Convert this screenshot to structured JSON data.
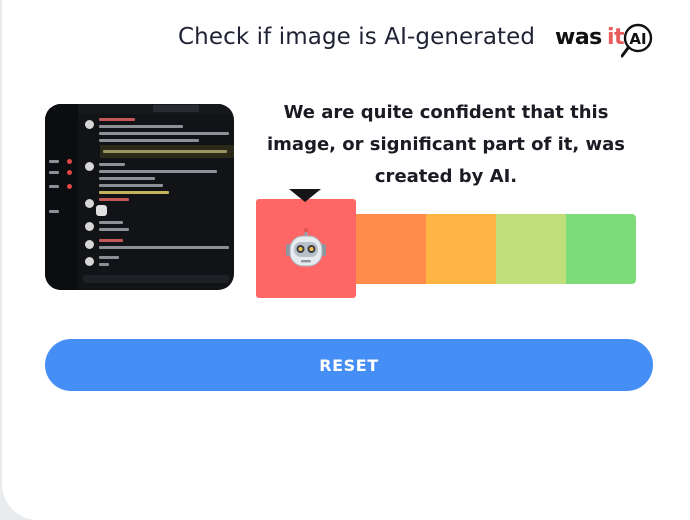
{
  "header": {
    "title": "Check if image is AI-generated",
    "logo": {
      "text_primary": "was",
      "text_accent": "it",
      "text_badge": "AI",
      "accent_color": "#e85c5c"
    }
  },
  "result": {
    "message": "We are quite confident that this image, or significant part of it, was created by AI.",
    "indicator_icon": "robot-face-icon",
    "scale_colors": [
      "#ff6766",
      "#ff8c4a",
      "#ffb444",
      "#c0df78",
      "#7cdc7a"
    ],
    "active_level": 0
  },
  "actions": {
    "reset_label": "RESET",
    "reset_color": "#448ef6"
  }
}
